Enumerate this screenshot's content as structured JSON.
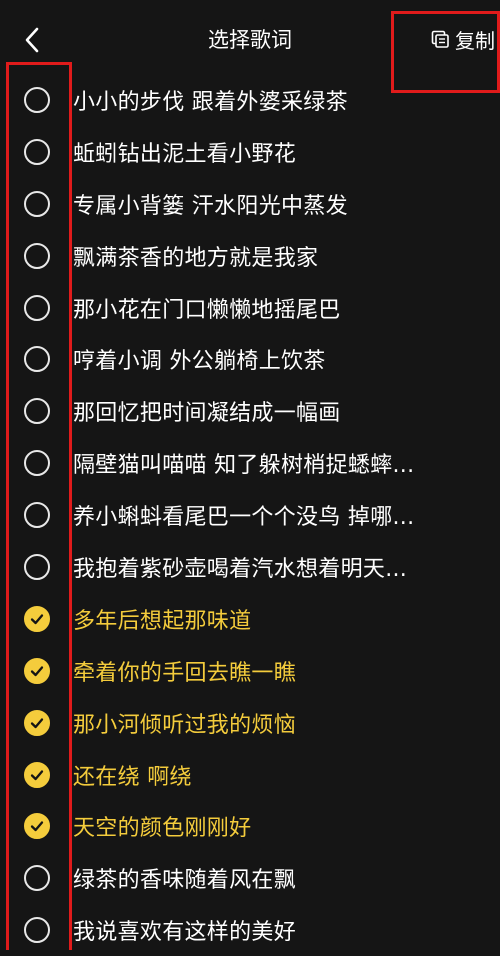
{
  "header": {
    "title": "选择歌词",
    "copy_label": "复制",
    "back_icon": "chevron-left-icon",
    "copy_icon": "copy-icon"
  },
  "colors": {
    "accent": "#f4cc3c",
    "highlight_box": "#e01b1b",
    "background": "#151515",
    "text": "#ffffff"
  },
  "lyrics": [
    {
      "text": "小小的步伐 跟着外婆采绿茶",
      "selected": false
    },
    {
      "text": "蚯蚓钻出泥土看小野花",
      "selected": false
    },
    {
      "text": "专属小背篓 汗水阳光中蒸发",
      "selected": false
    },
    {
      "text": "飘满茶香的地方就是我家",
      "selected": false
    },
    {
      "text": "那小花在门口懒懒地摇尾巴",
      "selected": false
    },
    {
      "text": "哼着小调 外公躺椅上饮茶",
      "selected": false
    },
    {
      "text": "那回忆把时间凝结成一幅画",
      "selected": false
    },
    {
      "text": "隔壁猫叫喵喵 知了躲树梢捉蟋蟀...",
      "selected": false
    },
    {
      "text": "养小蝌蚪看尾巴一个个没鸟 掉哪...",
      "selected": false
    },
    {
      "text": "我抱着紫砂壶喝着汽水想着明天...",
      "selected": false
    },
    {
      "text": "多年后想起那味道",
      "selected": true
    },
    {
      "text": "牵着你的手回去瞧一瞧",
      "selected": true
    },
    {
      "text": "那小河倾听过我的烦恼",
      "selected": true
    },
    {
      "text": "还在绕 啊绕",
      "selected": true
    },
    {
      "text": "天空的颜色刚刚好",
      "selected": true
    },
    {
      "text": "绿茶的香味随着风在飘",
      "selected": false
    },
    {
      "text": "我说喜欢有这样的美好",
      "selected": false
    }
  ]
}
